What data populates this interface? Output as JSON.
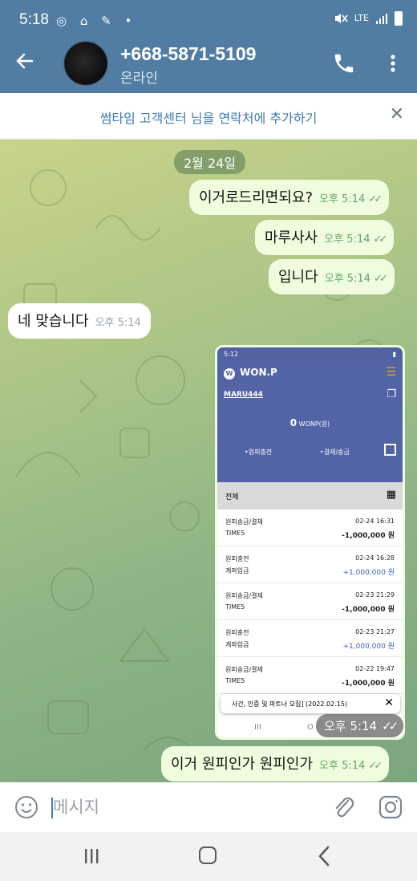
{
  "status_bar": {
    "time": "5:18",
    "left_icons": "◎ ⌂ ✎ •",
    "network": "LTE"
  },
  "header": {
    "contact_name": "+668-5871-5109",
    "contact_status": "온라인"
  },
  "banner": {
    "text": "썸타임 고객센터 님을 연락처에 추가하기",
    "close": "✕"
  },
  "chat": {
    "date": "2월 24일",
    "messages": [
      {
        "dir": "out",
        "text": "이거로드리면되요?",
        "time": "오후 5:14"
      },
      {
        "dir": "out",
        "text": "마루사사",
        "time": "오후 5:14"
      },
      {
        "dir": "out",
        "text": "입니다",
        "time": "오후 5:14"
      },
      {
        "dir": "in",
        "text": "네 맞습니다",
        "time": "오후 5:14"
      },
      {
        "dir": "out",
        "text": "이거 원피인가 원피인가",
        "time": "오후 5:14"
      }
    ],
    "photo_time": "오후 5:14"
  },
  "screenshot": {
    "status_time": "5:12",
    "app_name": "WON.P",
    "account": "MARU444",
    "balance_amount": "0",
    "balance_unit": "WONP(원)",
    "action_charge": "•원피충전",
    "action_pay": "•결제/송금",
    "filter_label": "전체",
    "transactions": [
      {
        "type": "원피송금/결제",
        "date": "02-24 16:31",
        "desc": "TIME5",
        "amount": "-1,000,000 원"
      },
      {
        "type": "원피충전",
        "date": "02-24 16:28",
        "desc": "계좌입금",
        "amount": "+1,000,000 원"
      },
      {
        "type": "원피송금/결제",
        "date": "02-23 21:29",
        "desc": "TIME5",
        "amount": "-1,000,000 원"
      },
      {
        "type": "원피충전",
        "date": "02-23 21:27",
        "desc": "계좌입금",
        "amount": "+1,000,000 원"
      },
      {
        "type": "원피송금/결제",
        "date": "02-22 19:47",
        "desc": "TIME5",
        "amount": "-1,000,000 원"
      }
    ],
    "popup_text": "사간, 인증 및 파트너 모집] (2022.02.15)",
    "popup_close": "✕",
    "nav_recent": "III",
    "nav_home": "O",
    "nav_back": "<"
  },
  "input": {
    "placeholder": "메시지"
  },
  "colors": {
    "header": "#517da2",
    "outgoing_bubble": "#effdde",
    "link": "#3f7ab5",
    "check": "#5fa56b"
  }
}
